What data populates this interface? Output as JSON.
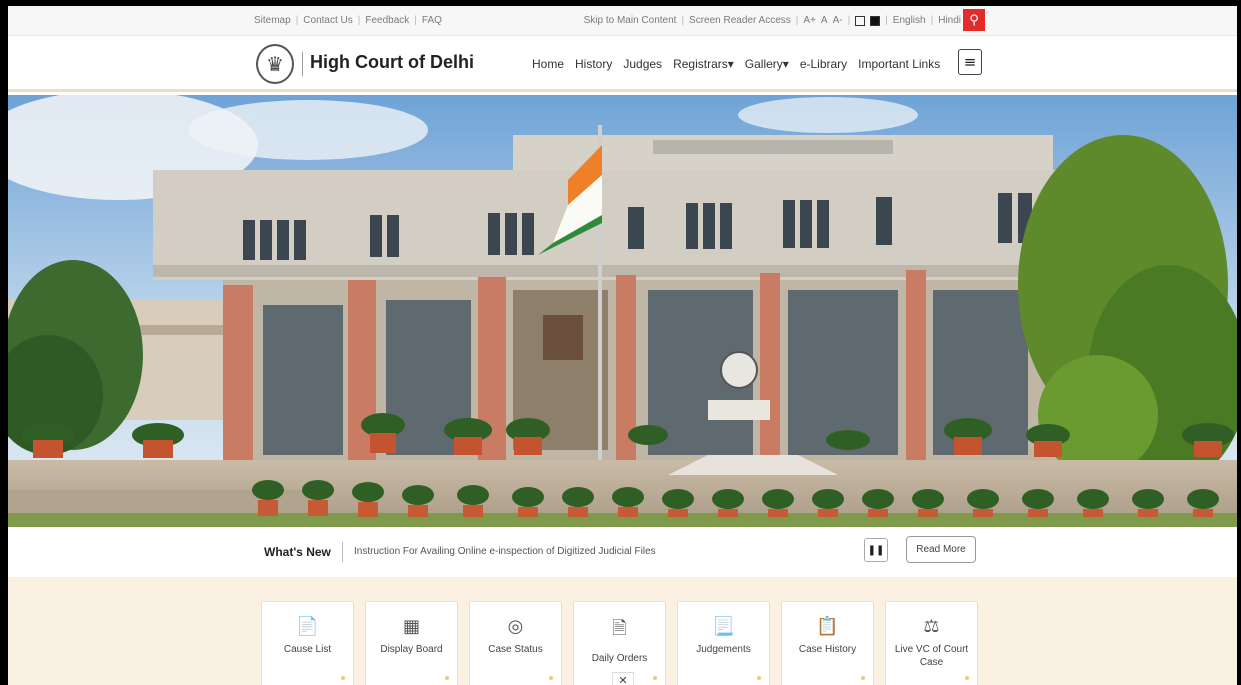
{
  "utility": {
    "left_links": [
      "Sitemap",
      "Contact Us",
      "Feedback",
      "FAQ"
    ],
    "skip": "Skip to Main Content",
    "reader": "Screen Reader Access",
    "font_sizes": [
      "A+",
      "A",
      "A-"
    ],
    "lang_en": "English",
    "lang_hi": "Hindi",
    "search_icon": "search-icon"
  },
  "header": {
    "title": "High Court of Delhi",
    "nav": [
      "Home",
      "History",
      "Judges",
      "Registrars▾",
      "Gallery▾",
      "e-Library",
      "Important Links"
    ],
    "menu_icon": "hamburger-icon"
  },
  "whats_new": {
    "label": "What's New",
    "text": "Instruction For Availing Online e-inspection of Digitized Judicial Files",
    "pause_icon": "pause-icon",
    "read_more": "Read More"
  },
  "services": [
    {
      "label": "Cause List",
      "icon": "📄"
    },
    {
      "label": "Display Board",
      "icon": "▦"
    },
    {
      "label": "Case Status",
      "icon": "◎"
    },
    {
      "label": "Daily Orders",
      "icon": "🗎"
    },
    {
      "label": "Judgements",
      "icon": "📃"
    },
    {
      "label": "Case History",
      "icon": "📋"
    },
    {
      "label": "Live VC of Court Case",
      "icon": "⚖"
    }
  ],
  "colors": {
    "accent_red": "#e32b2b",
    "services_bg": "#fbf1e3",
    "header_border": "#f1dcc1"
  }
}
